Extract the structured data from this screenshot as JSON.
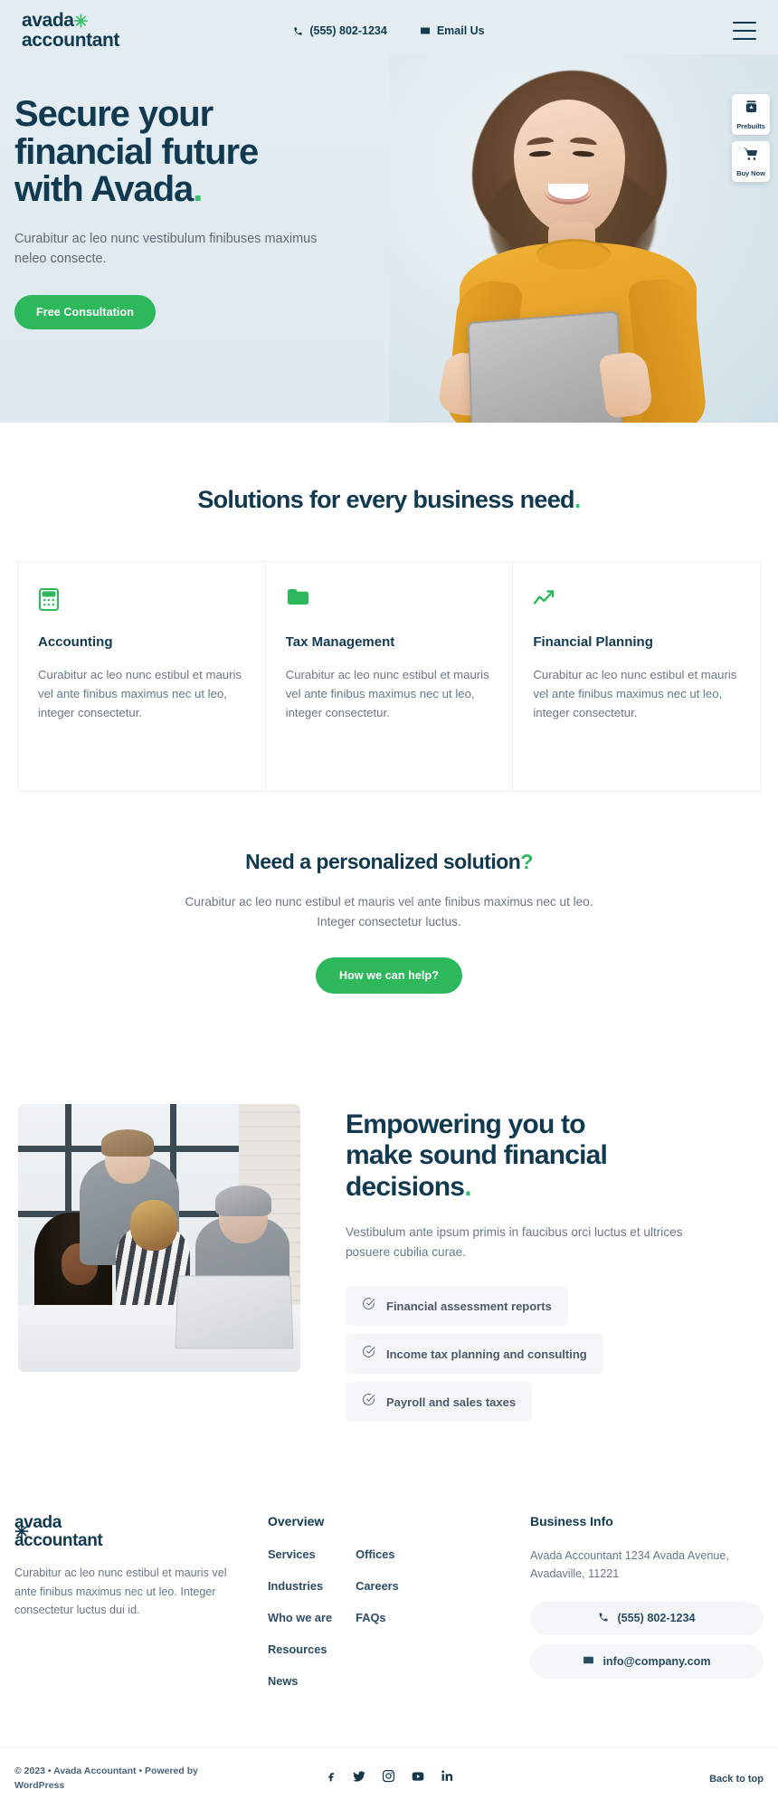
{
  "header": {
    "logo_line1": "avada",
    "logo_line2": "accountant",
    "logo_star": "✳",
    "phone": "(555) 802-1234",
    "email_label": "Email Us",
    "phone_icon": "phone-icon",
    "email_icon": "envelope-icon",
    "menu_icon": "hamburger-menu-icon"
  },
  "side_widgets": [
    {
      "label": "Prebuilts",
      "icon": "prebuilts-jar-icon"
    },
    {
      "label": "Buy Now",
      "icon": "shopping-cart-icon"
    }
  ],
  "hero": {
    "title_line1": "Secure your",
    "title_line2": "financial future",
    "title_line3": "with Avada",
    "title_dot": ".",
    "subtitle": "Curabitur ac leo nunc vestibulum finibuses maximus neleo consecte.",
    "cta_label": "Free Consultation",
    "image_alt": "smiling-woman-with-tablet-photo"
  },
  "solutions": {
    "title": "Solutions for every business need",
    "title_dot": ".",
    "cards": [
      {
        "icon": "calculator-icon",
        "title": "Accounting",
        "text": "Curabitur ac leo nunc estibul et mauris vel ante finibus maximus nec ut leo, integer consectetur."
      },
      {
        "icon": "folder-icon",
        "title": "Tax Management",
        "text": "Curabitur ac leo nunc estibul et mauris vel ante finibus maximus nec ut leo, integer consectetur."
      },
      {
        "icon": "trending-up-arrow-icon",
        "title": "Financial Planning",
        "text": "Curabitur ac leo nunc estibul et mauris vel ante finibus maximus nec ut leo, integer consectetur."
      }
    ]
  },
  "personalized": {
    "title": "Need a personalized solution",
    "title_mark": "?",
    "text": "Curabitur ac leo nunc estibul et mauris vel ante finibus maximus nec ut leo. Integer consectetur luctus.",
    "cta_label": "How we can help?"
  },
  "empower": {
    "image_alt": "team-working-on-laptop-photo",
    "title_line1": "Empowering you to",
    "title_line2": "make sound financial",
    "title_line3": "decisions",
    "title_dot": ".",
    "text": "Vestibulum ante ipsum primis in faucibus orci luctus et ultrices posuere cubilia curae.",
    "features": [
      {
        "icon": "check-circle-icon",
        "label": "Financial assessment reports"
      },
      {
        "icon": "check-circle-icon",
        "label": "Income tax planning and consulting"
      },
      {
        "icon": "check-circle-icon",
        "label": "Payroll and sales taxes"
      }
    ]
  },
  "footer": {
    "logo_line1": "avada",
    "logo_line2": "accountant",
    "logo_star": "✳",
    "description": "Curabitur ac leo nunc estibul et mauris vel ante finibus maximus nec ut leo. Integer consectetur luctus dui id.",
    "overview_heading": "Overview",
    "links_col1": [
      "Services",
      "Industries",
      "Who we are",
      "Resources",
      "News"
    ],
    "links_col2": [
      "Offices",
      "Careers",
      "FAQs"
    ],
    "business_heading": "Business Info",
    "address": "Avada Accountant 1234 Avada Avenue, Avadaville, 11221",
    "phone": "(555) 802-1234",
    "phone_icon": "phone-icon",
    "email": "info@company.com",
    "email_icon": "envelope-icon",
    "copyright_line1": "© 2023 • Avada Accountant • Powered by",
    "copyright_line2": "WordPress",
    "social": [
      {
        "name": "facebook-icon"
      },
      {
        "name": "twitter-icon"
      },
      {
        "name": "instagram-icon"
      },
      {
        "name": "youtube-icon"
      },
      {
        "name": "linkedin-icon"
      }
    ],
    "back_to_top": "Back to top"
  },
  "colors": {
    "brand_dark": "#11394f",
    "accent_green": "#2db85c",
    "logo_star_green": "#35c16a",
    "body_text": "#6b7885",
    "hero_bg": "#e2edf2"
  }
}
